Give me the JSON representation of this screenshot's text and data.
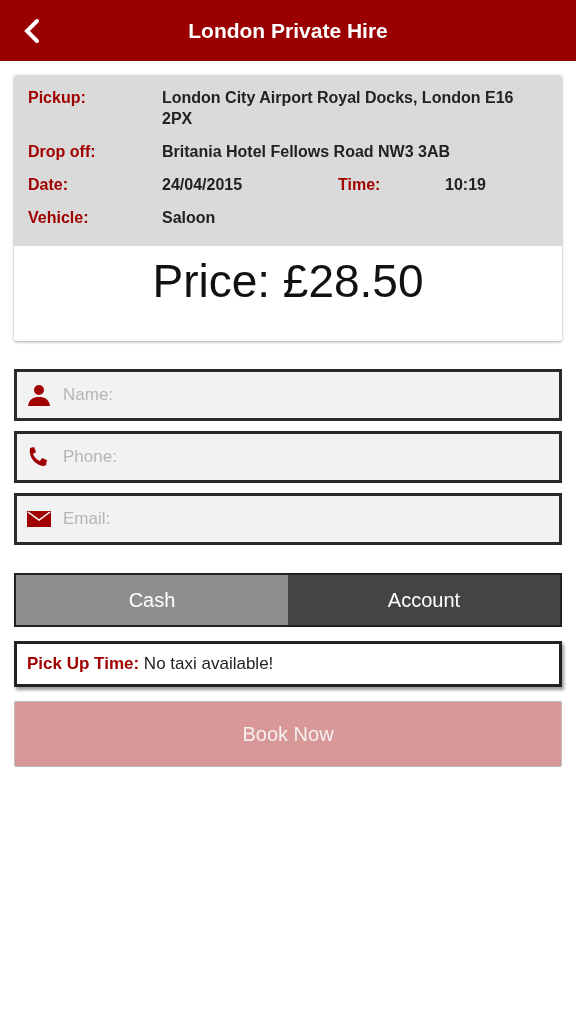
{
  "header": {
    "title": "London Private Hire"
  },
  "details": [
    {
      "pairs": [
        {
          "label": "Pickup:",
          "value": "London City Airport Royal Docks, London E16 2PX"
        }
      ]
    },
    {
      "pairs": [
        {
          "label": "Drop off:",
          "value": "Britania Hotel Fellows Road NW3 3AB"
        }
      ]
    },
    {
      "pairs": [
        {
          "label": "Date:",
          "value": "24/04/2015"
        },
        {
          "label": "Time:",
          "value": "10:19"
        }
      ]
    },
    {
      "pairs": [
        {
          "label": "Vehicle:",
          "value": "Saloon"
        }
      ]
    }
  ],
  "price": "Price: £28.50",
  "fields": [
    {
      "kind": "person",
      "placeholder": "Name:"
    },
    {
      "kind": "phone",
      "placeholder": "Phone:"
    },
    {
      "kind": "email",
      "placeholder": "Email:"
    }
  ],
  "payment": [
    {
      "label": "Cash",
      "selected": false
    },
    {
      "label": "Account",
      "selected": true
    }
  ],
  "pickup_time": "**Pick Up Time:** No taxi available!",
  "book_button": {
    "label": "Book Now",
    "disabled": true
  }
}
